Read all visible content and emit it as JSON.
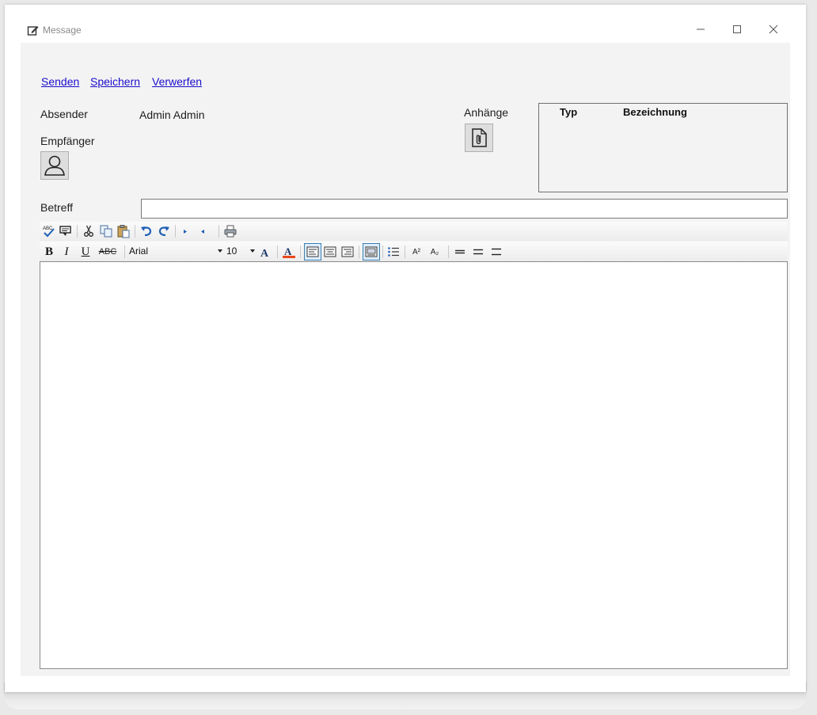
{
  "window": {
    "title": "Message",
    "icon": "edit-note-icon",
    "controls": [
      "minimize-icon",
      "maximize-icon",
      "close-icon"
    ]
  },
  "actions": {
    "send": "Senden",
    "save": "Speichern",
    "discard": "Verwerfen"
  },
  "sender": {
    "label": "Absender",
    "value": "Admin Admin"
  },
  "recipient": {
    "label": "Empfänger",
    "icon": "user-icon"
  },
  "attachments": {
    "label": "Anhänge",
    "icon": "attachment-file-icon",
    "columns": [
      "Typ",
      "Bezeichnung"
    ],
    "rows": []
  },
  "subject": {
    "label": "Betreff",
    "value": ""
  },
  "toolbar1": {
    "icons": [
      "spellcheck-icon",
      "comment-icon",
      "cut-icon",
      "copy-icon",
      "paste-icon",
      "undo-icon",
      "redo-icon",
      "outdent-icon",
      "indent-icon",
      "print-icon"
    ]
  },
  "toolbar2": {
    "bold": "B",
    "italic": "I",
    "underline": "U",
    "strike": "ABC",
    "font": "Arial",
    "size": "10",
    "superscript": "A²",
    "subscript": "A₂",
    "icons": [
      "font-size-icon",
      "font-color-icon",
      "align-left-icon",
      "align-center-icon",
      "align-right-icon",
      "word-wrap-icon",
      "bullet-list-icon",
      "line-1-icon",
      "line-2-icon",
      "line-3-icon"
    ],
    "colors": {
      "font_color_bar": "#e8491d",
      "active_border": "#3c7fb1"
    }
  },
  "editor": {
    "content": ""
  }
}
